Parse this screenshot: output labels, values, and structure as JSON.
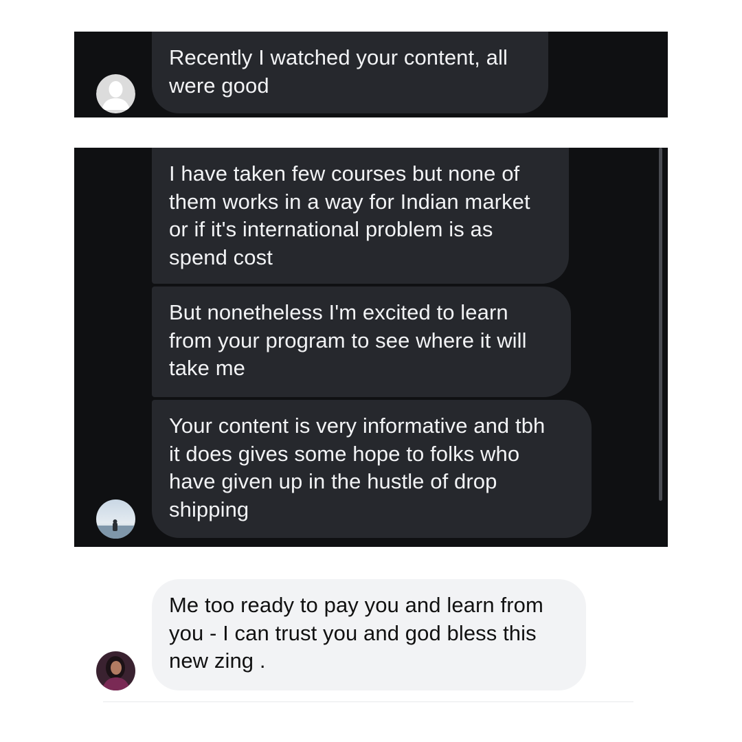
{
  "conversation": {
    "screenshot1": {
      "messages": [
        {
          "text": "Recently I watched your content, all\nwere good"
        }
      ],
      "avatar_icon": "default-user-avatar-icon"
    },
    "screenshot2": {
      "messages": [
        {
          "text": "I have taken few courses but none of\nthem works in a way for Indian market\nor if it's international problem is as\nspend cost"
        },
        {
          "text": "But nonetheless I'm excited to learn\nfrom your program to see where it will\ntake me"
        },
        {
          "text": "Your content is very informative and tbh\nit does gives some hope to folks who\nhave given up in the hustle of drop\nshipping"
        }
      ],
      "avatar_icon": "beach-photo-avatar"
    },
    "screenshot3": {
      "messages": [
        {
          "text": "Me too ready to pay you and learn from\nyou - I can trust you and god bless this\nnew zing ."
        }
      ],
      "avatar_icon": "portrait-photo-avatar"
    }
  },
  "colors": {
    "dark_panel": "#0f1012",
    "dark_bubble": "#26282d",
    "light_bubble": "#f2f3f5",
    "text_on_dark": "#f2f3f5",
    "text_on_light": "#111111"
  }
}
